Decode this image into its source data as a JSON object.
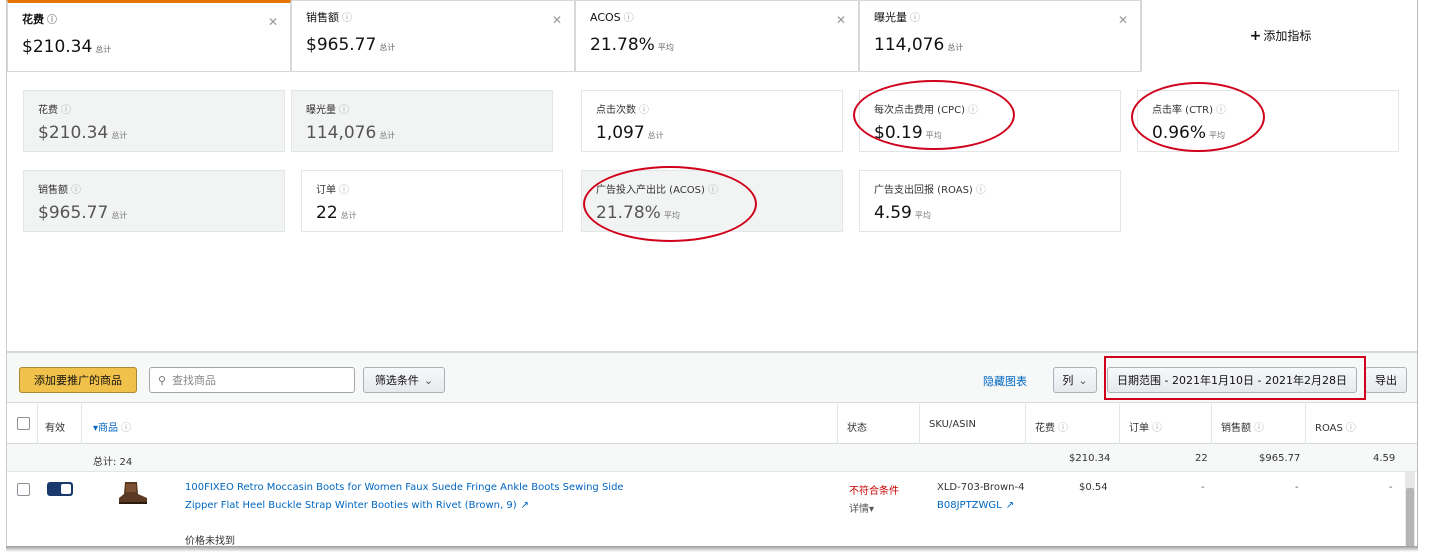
{
  "tabs": [
    {
      "label": "花费",
      "value": "$210.34",
      "unit": "总计"
    },
    {
      "label": "销售额",
      "value": "$965.77",
      "unit": "总计"
    },
    {
      "label": "ACOS",
      "value": "21.78%",
      "unit": "平均"
    },
    {
      "label": "曝光量",
      "value": "114,076",
      "unit": "总计"
    }
  ],
  "add_metric_label": "添加指标",
  "cards": [
    {
      "label": "花费",
      "value": "$210.34",
      "unit": "总计"
    },
    {
      "label": "曝光量",
      "value": "114,076",
      "unit": "总计"
    },
    {
      "label": "点击次数",
      "value": "1,097",
      "unit": "总计"
    },
    {
      "label": "每次点击费用 (CPC)",
      "value": "$0.19",
      "unit": "平均"
    },
    {
      "label": "点击率 (CTR)",
      "value": "0.96%",
      "unit": "平均"
    },
    {
      "label": "销售额",
      "value": "$965.77",
      "unit": "总计"
    },
    {
      "label": "订单",
      "value": "22",
      "unit": "总计"
    },
    {
      "label": "广告投入产出比 (ACOS)",
      "value": "21.78%",
      "unit": "平均"
    },
    {
      "label": "广告支出回报 (ROAS)",
      "value": "4.59",
      "unit": "平均"
    }
  ],
  "toolbar": {
    "add_products": "添加要推广的商品",
    "search_placeholder": "查找商品",
    "filter": "筛选条件",
    "hide_chart": "隐藏图表",
    "columns": "列",
    "date_range": "日期范围 - 2021年1月10日 - 2021年2月28日",
    "export": "导出"
  },
  "table": {
    "headers": {
      "active": "有效",
      "product": "商品",
      "status": "状态",
      "sku": "SKU/ASIN",
      "spend": "花费",
      "orders": "订单",
      "sales": "销售额",
      "roas": "ROAS"
    },
    "totals": {
      "label": "总计: 24",
      "spend": "$210.34",
      "orders": "22",
      "sales": "$965.77",
      "roas": "4.59"
    },
    "rows": [
      {
        "title_line1": "100FIXEO Retro Moccasin Boots for Women Faux Suede Fringe Ankle Boots Sewing Side",
        "title_line2": "Zipper Flat Heel Buckle Strap Winter Booties with Rivet (Brown, 9)",
        "status": "不符合条件",
        "status_detail": "详情",
        "sku": "XLD-703-Brown-4",
        "asin": "B08JPTZWGL",
        "spend": "$0.54",
        "orders": "-",
        "sales": "-",
        "roas": "-",
        "price_note": "价格未找到"
      }
    ]
  },
  "colors": {
    "accent": "#e77600",
    "highlight": "#d0021b",
    "primary_button": "#f0c14b",
    "link": "#0066c0"
  }
}
